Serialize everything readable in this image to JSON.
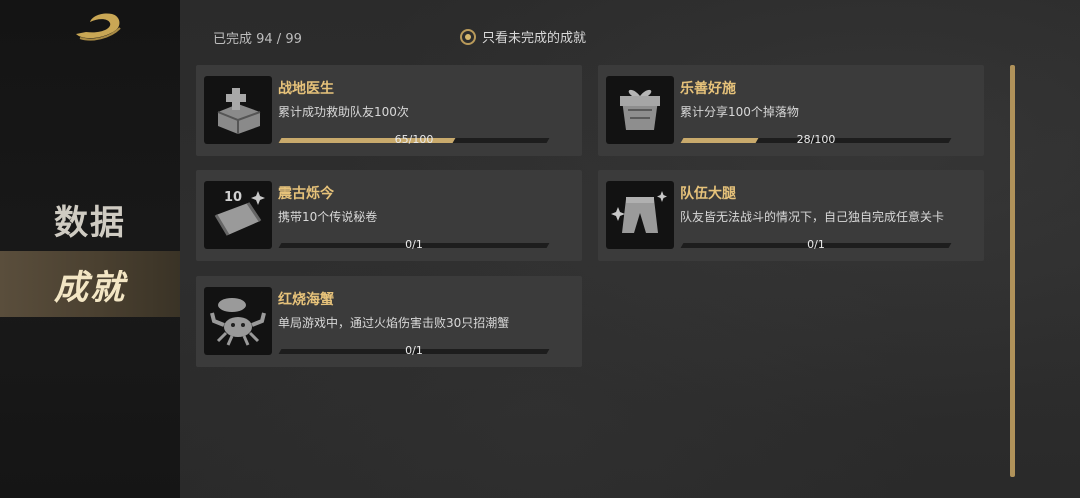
{
  "sidebar": {
    "logo_icon": "golden-swirl-logo-icon",
    "items": [
      {
        "label": "数据",
        "active": false
      },
      {
        "label": "成就",
        "active": true
      }
    ]
  },
  "header": {
    "completed_text": "已完成 94 / 99",
    "filter_label": "只看未完成的成就",
    "filter_selected": true
  },
  "accent_color": "#c9aa6c",
  "title_color": "#e6c27a",
  "achievements": [
    {
      "title": "战地医生",
      "desc": "累计成功救助队友100次",
      "progress": "65/100",
      "fraction": 0.65,
      "icon": "medkit-box-icon"
    },
    {
      "title": "乐善好施",
      "desc": "累计分享100个掉落物",
      "progress": "28/100",
      "fraction": 0.28,
      "icon": "gift-box-icon"
    },
    {
      "title": "震古烁今",
      "desc": "携带10个传说秘卷",
      "progress": "0/1",
      "fraction": 0,
      "icon": "scroll-10-icon"
    },
    {
      "title": "队伍大腿",
      "desc": "队友皆无法战斗的情况下，自己独自完成任意关卡",
      "progress": "0/1",
      "fraction": 0,
      "icon": "pants-icon"
    },
    {
      "title": "红烧海蟹",
      "desc": "单局游戏中，通过火焰伤害击败30只招潮蟹",
      "progress": "0/1",
      "fraction": 0,
      "icon": "crab-icon"
    }
  ]
}
